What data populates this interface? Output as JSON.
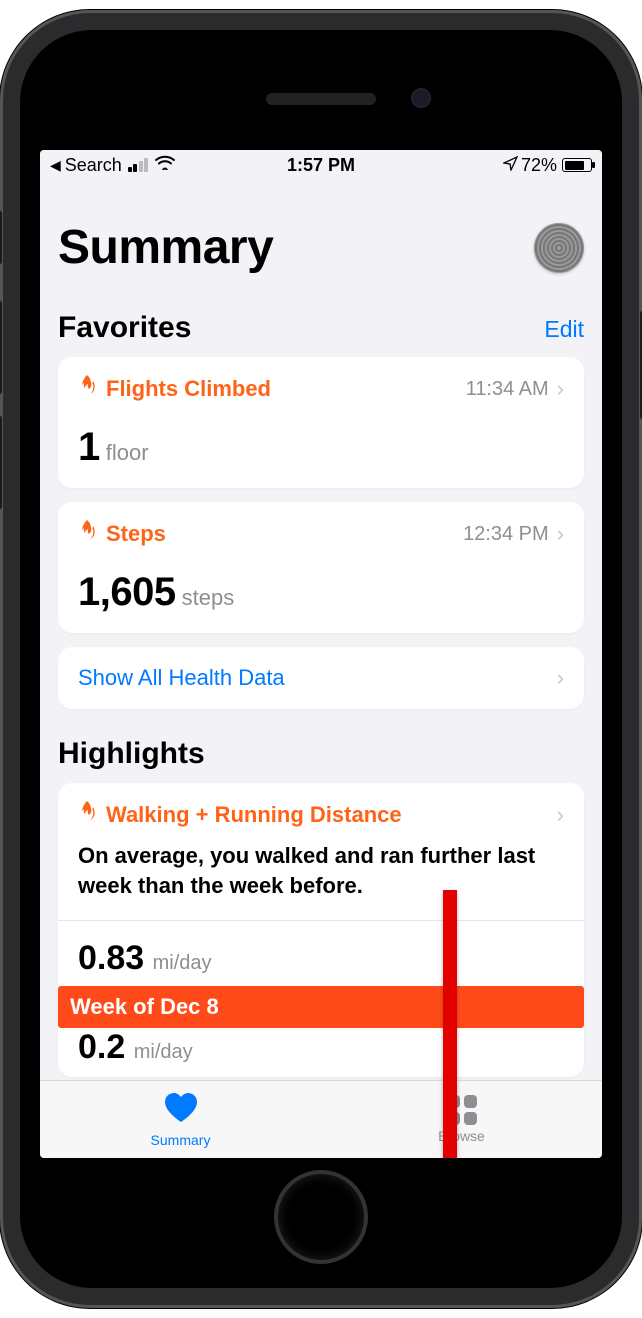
{
  "status_bar": {
    "back_app": "Search",
    "time": "1:57 PM",
    "battery_pct": "72%"
  },
  "header": {
    "title": "Summary"
  },
  "favorites": {
    "title": "Favorites",
    "edit": "Edit",
    "items": [
      {
        "icon": "flame",
        "title": "Flights Climbed",
        "time": "11:34 AM",
        "value": "1",
        "unit": "floor"
      },
      {
        "icon": "flame",
        "title": "Steps",
        "time": "12:34 PM",
        "value": "1,605",
        "unit": "steps"
      }
    ],
    "show_all": "Show All Health Data"
  },
  "highlights": {
    "title": "Highlights",
    "item": {
      "icon": "flame",
      "title": "Walking + Running Distance",
      "desc": "On average, you walked and ran further last week than the week before.",
      "value1": "0.83",
      "unit1": "mi/day",
      "week_label": "Week of Dec 8",
      "value2": "0.2",
      "unit2": "mi/day"
    }
  },
  "tabbar": {
    "summary": "Summary",
    "browse": "Browse"
  }
}
